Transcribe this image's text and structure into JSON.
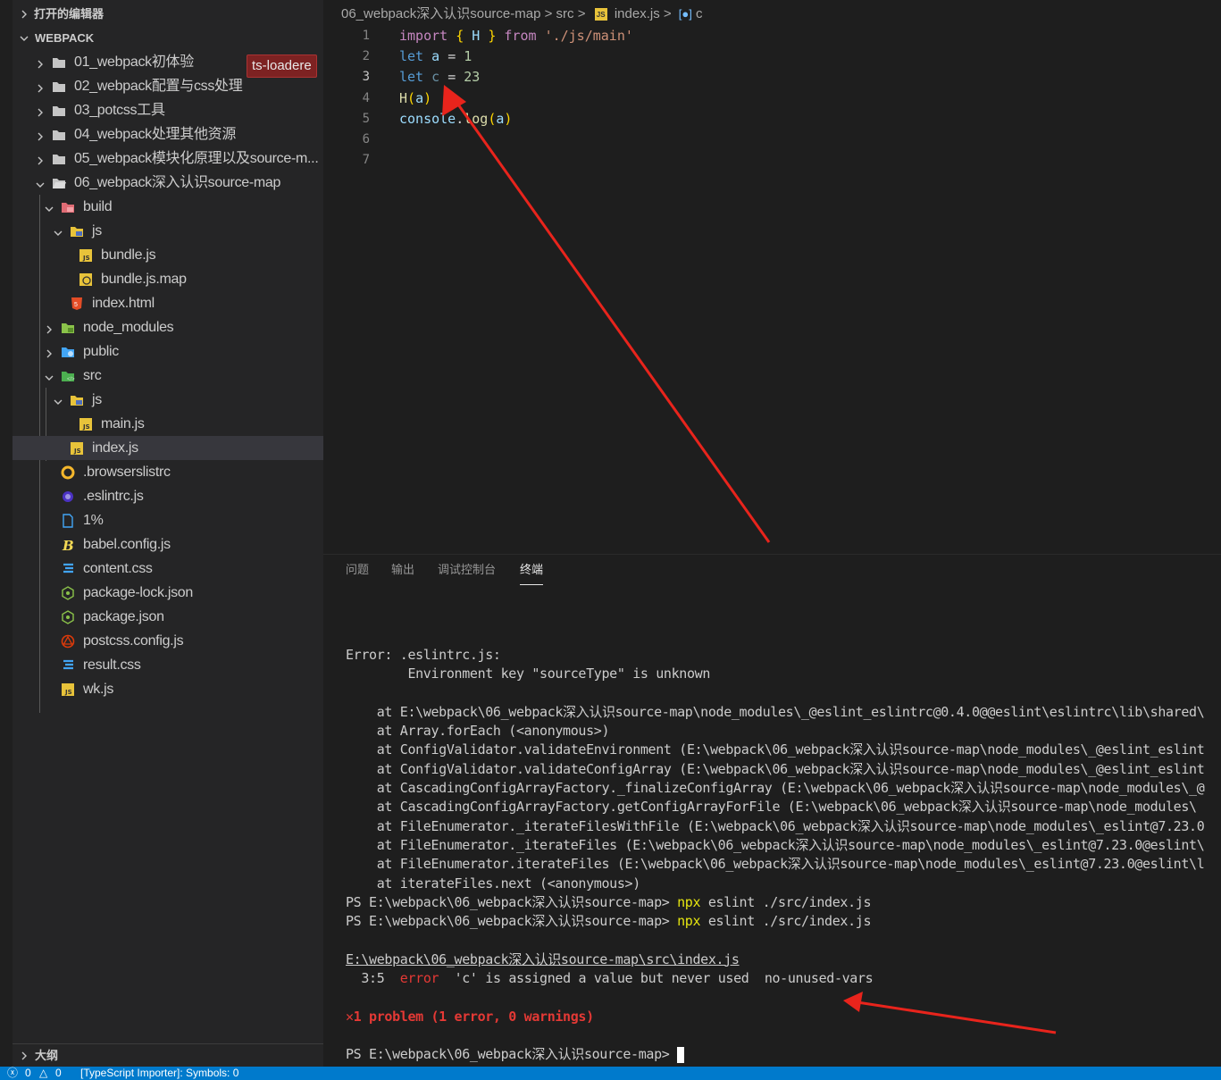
{
  "sidebar": {
    "open_editors_label": "打开的编辑器",
    "workspace_label": "WEBPACK",
    "outline_label": "大纲",
    "badge": "ts-loadere",
    "items": [
      {
        "label": "01_webpack初体验"
      },
      {
        "label": "02_webpack配置与css处理"
      },
      {
        "label": "03_potcss工具"
      },
      {
        "label": "04_webpack处理其他资源"
      },
      {
        "label": "05_webpack模块化原理以及source-m..."
      },
      {
        "label": "06_webpack深入认识source-map"
      },
      {
        "label": "build"
      },
      {
        "label": "js"
      },
      {
        "label": "bundle.js"
      },
      {
        "label": "bundle.js.map"
      },
      {
        "label": "index.html"
      },
      {
        "label": "node_modules"
      },
      {
        "label": "public"
      },
      {
        "label": "src"
      },
      {
        "label": "js"
      },
      {
        "label": "main.js"
      },
      {
        "label": "index.js"
      },
      {
        "label": ".browserslistrc"
      },
      {
        "label": ".eslintrc.js"
      },
      {
        "label": "1%"
      },
      {
        "label": "babel.config.js"
      },
      {
        "label": "content.css"
      },
      {
        "label": "package-lock.json"
      },
      {
        "label": "package.json"
      },
      {
        "label": "postcss.config.js"
      },
      {
        "label": "result.css"
      },
      {
        "label": "wk.js"
      }
    ]
  },
  "breadcrumb": {
    "folder": "06_webpack深入认识source-map",
    "sep": ">",
    "src": "src",
    "file": "index.js",
    "symbol": "c"
  },
  "editor": {
    "line_numbers": [
      "1",
      "2",
      "3",
      "4",
      "5",
      "6",
      "7"
    ],
    "lines": {
      "l1": {
        "kw": "import",
        "open": "{",
        "name": "H",
        "close": "}",
        "from": "from",
        "path": "'./js/main'"
      },
      "l2": {
        "kw": "let",
        "name": "a",
        "eq": "=",
        "val": "1"
      },
      "l3": {
        "kw": "let",
        "name": "c",
        "eq": "=",
        "val": "23"
      },
      "l4": {
        "fn": "H",
        "open": "(",
        "arg": "a",
        "close": ")"
      },
      "l5": {
        "obj": "console",
        "dot": ".",
        "fn": "log",
        "open": "(",
        "arg": "a",
        "close": ")"
      }
    }
  },
  "panel": {
    "tabs": [
      "问题",
      "输出",
      "调试控制台",
      "终端"
    ]
  },
  "terminal": {
    "error_head": "Error: .eslintrc.js:",
    "error_detail": "        Environment key \"sourceType\" is unknown",
    "stack": [
      "    at E:\\webpack\\06_webpack深入认识source-map\\node_modules\\_@eslint_eslintrc@0.4.0@@eslint\\eslintrc\\lib\\shared\\",
      "    at Array.forEach (<anonymous>)",
      "    at ConfigValidator.validateEnvironment (E:\\webpack\\06_webpack深入认识source-map\\node_modules\\_@eslint_eslint",
      "    at ConfigValidator.validateConfigArray (E:\\webpack\\06_webpack深入认识source-map\\node_modules\\_@eslint_eslint",
      "    at CascadingConfigArrayFactory._finalizeConfigArray (E:\\webpack\\06_webpack深入认识source-map\\node_modules\\_@",
      "    at CascadingConfigArrayFactory.getConfigArrayForFile (E:\\webpack\\06_webpack深入认识source-map\\node_modules\\",
      "    at FileEnumerator._iterateFilesWithFile (E:\\webpack\\06_webpack深入认识source-map\\node_modules\\_eslint@7.23.0",
      "    at FileEnumerator._iterateFiles (E:\\webpack\\06_webpack深入认识source-map\\node_modules\\_eslint@7.23.0@eslint\\",
      "    at FileEnumerator.iterateFiles (E:\\webpack\\06_webpack深入认识source-map\\node_modules\\_eslint@7.23.0@eslint\\l",
      "    at iterateFiles.next (<anonymous>)"
    ],
    "prompt": "PS E:\\webpack\\06_webpack深入认识source-map> ",
    "cmd_npx": "npx",
    "cmd_rest": " eslint ./src/index.js",
    "file_path": "E:\\webpack\\06_webpack深入认识source-map\\src\\index.js",
    "err_loc": "  3:5",
    "err_word": "error",
    "err_msg": "'c' is assigned a value but never used",
    "err_rule": "no-unused-vars",
    "summary": "✕1 problem (1 error, 0 warnings)",
    "final_prompt": "PS E:\\webpack\\06_webpack深入认识source-map> "
  },
  "statusbar": {
    "errors": "0",
    "warnings": "0",
    "text": "[TypeScript Importer]: Symbols: 0"
  },
  "colors": {
    "accent": "#007acc",
    "annotation_arrow": "#e8241c",
    "badge_bg": "#7d2222"
  }
}
